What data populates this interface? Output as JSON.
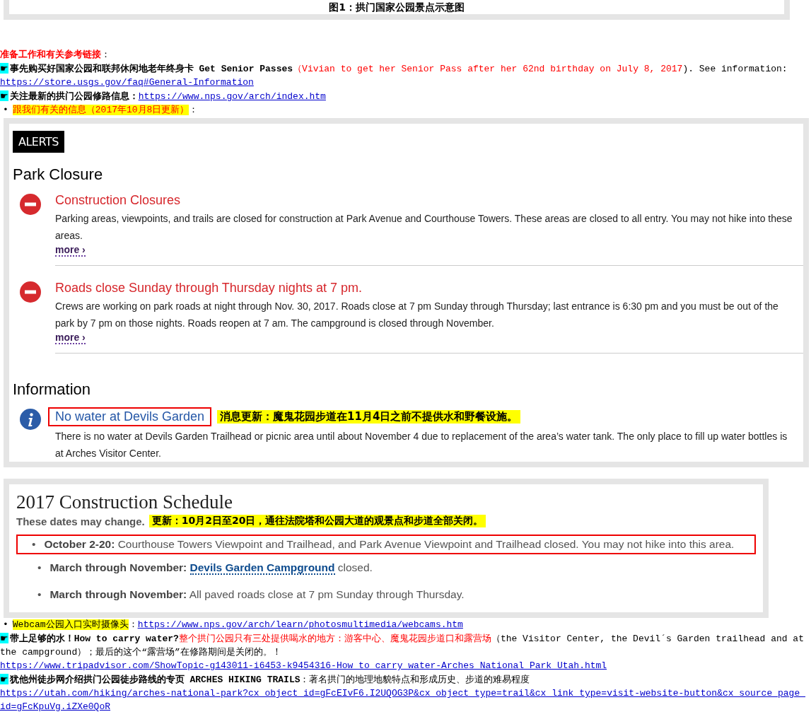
{
  "caption": "图1：拱门国家公园景点示意图",
  "intro": [
    {
      "segments": [
        {
          "kind": "red-bold",
          "text": "准备工作和有关参考链接"
        },
        {
          "kind": "plain",
          "text": "："
        }
      ]
    },
    {
      "marker": "☛",
      "segments": [
        {
          "kind": "bold",
          "text": "事先购买好国家公园和联邦休闲地老年终身卡 Get Senior Passes"
        },
        {
          "kind": "red",
          "text": "（Vivian to get her Senior Pass after her 62nd birthday on July 8, 2017"
        },
        {
          "kind": "plain",
          "text": "). See information:"
        },
        {
          "kind": "link",
          "text": "https://store.usgs.gov/faq#General-Information"
        }
      ]
    },
    {
      "marker": "☛",
      "segments": [
        {
          "kind": "bold",
          "text": "关注最新的拱门公园修路信息："
        },
        {
          "kind": "link",
          "text": "https://www.nps.gov/arch/index.htm"
        }
      ]
    },
    {
      "marker": "•",
      "segments": [
        {
          "kind": "highlight-red",
          "text": "跟我们有关的信息（2017年10月8日更新）"
        },
        {
          "kind": "plain",
          "text": "："
        }
      ]
    }
  ],
  "alerts": {
    "badge": "ALERTS",
    "sections": [
      {
        "heading": "Park Closure",
        "items": [
          {
            "kind": "closure",
            "title": "Construction Closures",
            "boxed": false,
            "body": "Parking areas, viewpoints, and trails are closed for construction at Park Avenue and Courthouse Towers. These areas are closed to all entry. You may not hike into these areas.",
            "more": "more ›"
          },
          {
            "kind": "closure",
            "title": "Roads close Sunday through Thursday nights at 7 pm.",
            "boxed": false,
            "body": "Crews are working on park roads at night through Nov. 30, 2017. Roads close at 7 pm Sunday through Thursday; last entrance is 6:30 pm and you must be out of the park by 7 pm on those nights. Roads reopen at 7 am. The campground is closed through November.",
            "more": "more ›"
          }
        ]
      },
      {
        "heading": "Information",
        "items": [
          {
            "kind": "info",
            "title": "No water at Devils Garden",
            "boxed": true,
            "note": "消息更新：魔鬼花园步道在11月4日之前不提供水和野餐设施。",
            "body": "There is no water at Devils Garden Trailhead or picnic area until about November 4 due to replacement of the area’s water tank. The only place to fill up water bottles is at Arches Visitor Center."
          }
        ]
      }
    ]
  },
  "schedule": {
    "title": "2017 Construction Schedule",
    "subtitle": "These dates may change.",
    "note": "更新：10月2日至20日，通往法院塔和公园大道的观景点和步道全部关闭。",
    "items": [
      {
        "marker": "•",
        "label": "October 2-20:",
        "boxed": true,
        "text": "Courthouse Towers Viewpoint and Trailhead, and Park Avenue Viewpoint and Trailhead closed. You may not hike into this area."
      },
      {
        "marker": "•",
        "label": "March through November:",
        "boxed": false,
        "link": "Devils Garden Campground",
        "text": "closed."
      },
      {
        "marker": "•",
        "label": "March through November:",
        "boxed": false,
        "text": "All paved roads close at 7 pm Sunday through Thursday."
      }
    ]
  },
  "outro": [
    {
      "marker": "•",
      "segments": [
        {
          "kind": "highlight",
          "text": "Webcam公园入口实时摄像头"
        },
        {
          "kind": "plain",
          "text": "："
        },
        {
          "kind": "link",
          "text": "https://www.nps.gov/arch/learn/photosmultimedia/webcams.htm"
        }
      ]
    },
    {
      "marker": "☛",
      "segments": [
        {
          "kind": "bold",
          "text": "带上足够的水！How to carry water?"
        },
        {
          "kind": "red",
          "text": "整个拱门公园只有三处提供喝水的地方：游客中心、魔鬼花园步道口和露营场"
        },
        {
          "kind": "plain",
          "text": "（the Visitor Center, the Devil´s Garden trailhead and at the campground）；最后的这个“露营场”在修路期间是关闭的。！"
        },
        {
          "kind": "url-block",
          "text": "https://www.tripadvisor.com/ShowTopic-g143011-i6453-k9454316-How_to_carry_water-Arches_National_Park_Utah.html"
        }
      ]
    },
    {
      "marker": "☛",
      "segments": [
        {
          "kind": "bold",
          "text": "犹他州徒步网介绍拱门公园徒步路线的专页 ARCHES HIKING TRAILS"
        },
        {
          "kind": "plain",
          "text": "：著名拱门的地理地貌特点和形成历史、步道的难易程度"
        },
        {
          "kind": "url-block",
          "text": "https://utah.com/hiking/arches-national-park?cx_object_id=gFcEIvF6.I2UQOG3P&cx_object_type=trail&cx_link_type=visit-website-button&cx_source_page_id=gFcKpuVg.iZXe0QoR"
        }
      ]
    }
  ]
}
